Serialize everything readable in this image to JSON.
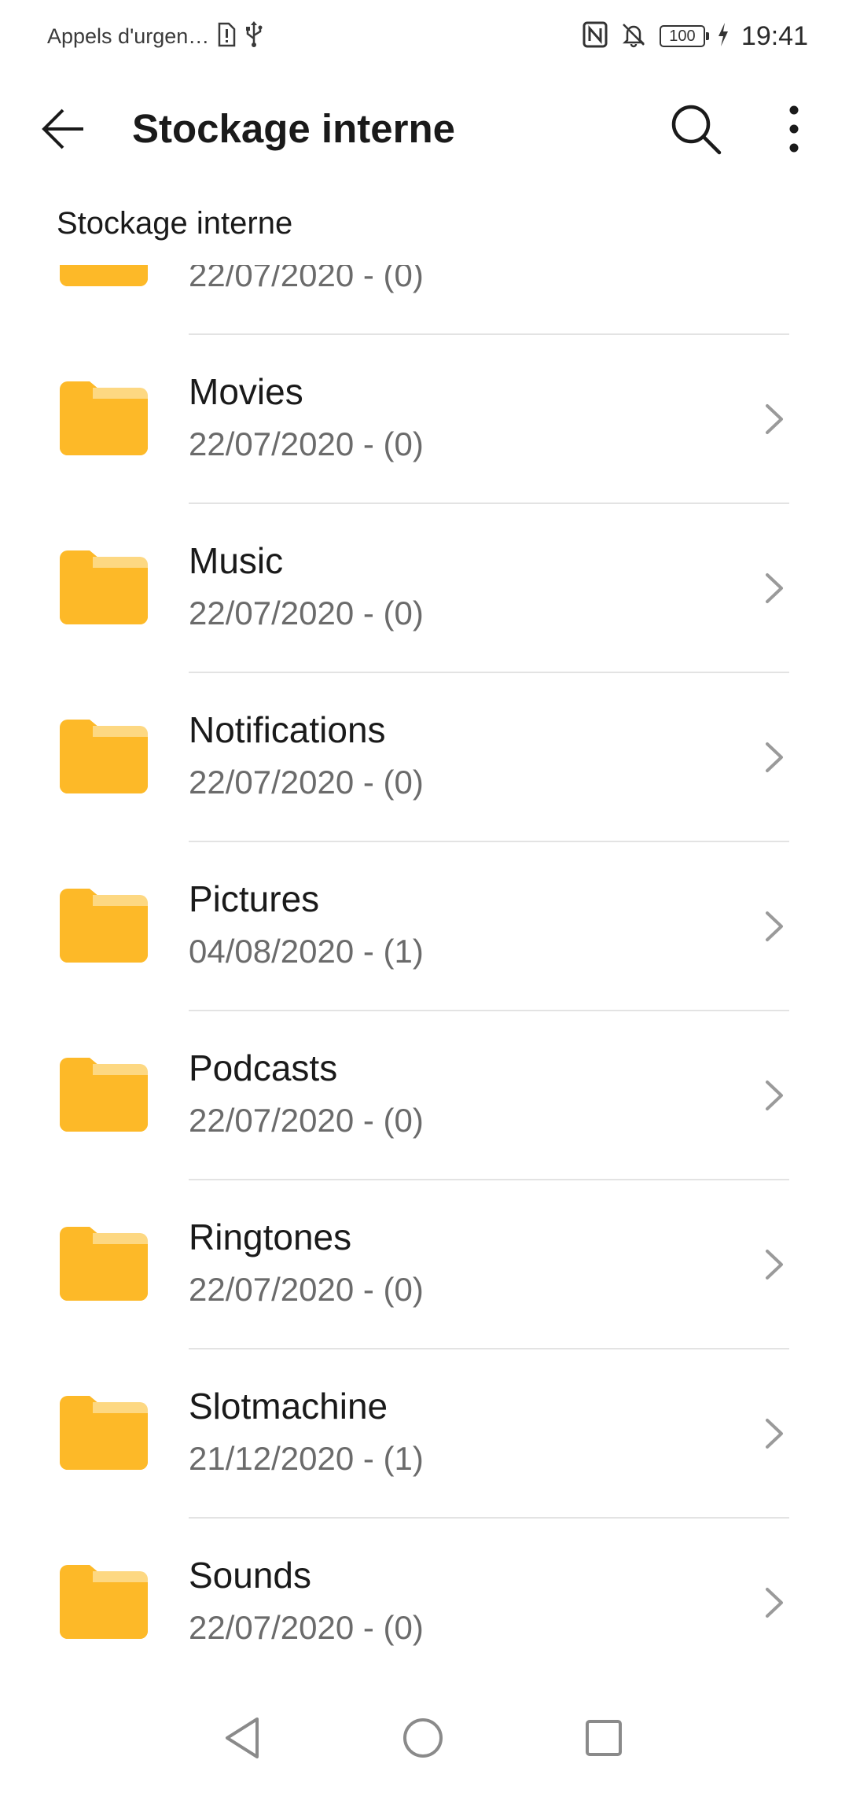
{
  "status_bar": {
    "carrier": "Appels d'urgen…",
    "time": "19:41",
    "battery_level": "100",
    "icons": [
      "sim-alert-icon",
      "usb-icon",
      "nfc-icon",
      "bell-off-icon",
      "battery-icon",
      "charging-icon"
    ]
  },
  "app_bar": {
    "title": "Stockage interne",
    "icons": [
      "back-arrow-icon",
      "search-icon",
      "more-vert-icon"
    ]
  },
  "breadcrumb": {
    "label": "Stockage interne"
  },
  "folders": [
    {
      "name": "",
      "meta": "22/07/2020 - (0)"
    },
    {
      "name": "Movies",
      "meta": "22/07/2020 - (0)"
    },
    {
      "name": "Music",
      "meta": "22/07/2020 - (0)"
    },
    {
      "name": "Notifications",
      "meta": "22/07/2020 - (0)"
    },
    {
      "name": "Pictures",
      "meta": "04/08/2020 - (1)"
    },
    {
      "name": "Podcasts",
      "meta": "22/07/2020 - (0)"
    },
    {
      "name": "Ringtones",
      "meta": "22/07/2020 - (0)"
    },
    {
      "name": "Slotmachine",
      "meta": "21/12/2020 - (1)"
    },
    {
      "name": "Sounds",
      "meta": "22/07/2020 - (0)"
    }
  ],
  "colors": {
    "folder": "#FDB928",
    "folder_tab": "#FDD882",
    "divider": "#E3E3E3",
    "meta_text": "#6B6B6B"
  },
  "nav_bar": {
    "icons": [
      "nav-back-icon",
      "nav-home-icon",
      "nav-recents-icon"
    ]
  }
}
